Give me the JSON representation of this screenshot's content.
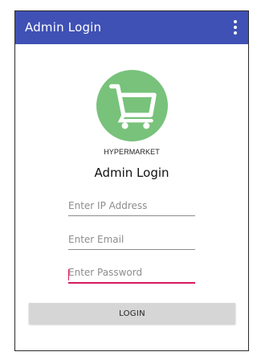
{
  "colors": {
    "appbar": "#3f51b5",
    "appbar_text": "#ffffff",
    "logo_bg": "#78c27b",
    "focus_accent": "#d81b60",
    "button_bg": "#d6d6d6"
  },
  "appbar": {
    "title": "Admin Login",
    "menu_icon": "more-vert-icon"
  },
  "logo": {
    "icon": "shopping-cart-icon",
    "brand": "HYPERMARKET"
  },
  "form": {
    "heading": "Admin Login",
    "ip_placeholder": "Enter IP Address",
    "email_placeholder": "Enter Email",
    "password_placeholder": "Enter Password",
    "login_label": "LOGIN"
  }
}
